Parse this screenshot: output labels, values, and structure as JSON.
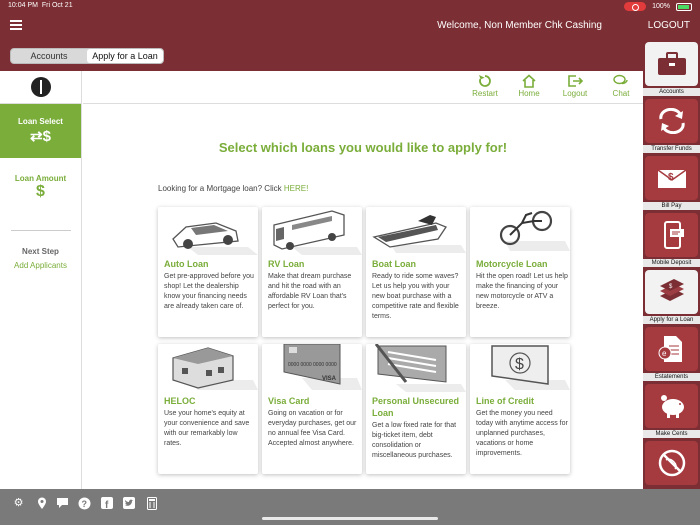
{
  "status": {
    "time": "10:04 PM",
    "date": "Fri Oct 21",
    "battery": "100%"
  },
  "header": {
    "welcome": "Welcome, Non Member Chk Cashing",
    "logout": "LOGOUT"
  },
  "tabs": [
    {
      "label": "Accounts"
    },
    {
      "label": "Apply for a Loan"
    }
  ],
  "steps": {
    "loan_select": "Loan Select",
    "loan_amount": "Loan Amount",
    "next_step": "Next Step",
    "add_applicants": "Add Applicants"
  },
  "toolbar": {
    "restart": "Restart",
    "home": "Home",
    "logout": "Logout",
    "chat": "Chat"
  },
  "main": {
    "headline": "Select which loans you would like to apply for!",
    "mortgage_prefix": "Looking for a Mortgage loan? Click ",
    "mortgage_link": "HERE!"
  },
  "loans": [
    {
      "title": "Auto Loan",
      "desc": "Get pre-approved before you shop! Let the dealership know your financing needs are already taken care of."
    },
    {
      "title": "RV Loan",
      "desc": "Make that dream purchase and hit the road with an affordable RV Loan that's perfect for you."
    },
    {
      "title": "Boat Loan",
      "desc": "Ready to ride some waves? Let us help you with your new boat purchase with a competitive rate and flexible terms."
    },
    {
      "title": "Motorcycle Loan",
      "desc": "Hit the open road! Let us help make the financing of your new motorcycle or ATV a breeze."
    },
    {
      "title": "HELOC",
      "desc": "Use your home's equity at your convenience and save with our remarkably low rates."
    },
    {
      "title": "Visa Card",
      "desc": "Going on vacation or for everyday purchases, get our no annual fee Visa Card. Accepted almost anywhere."
    },
    {
      "title": "Personal Unsecured Loan",
      "desc": "Get a low fixed rate for that big-ticket item, debt consolidation or miscellaneous purchases."
    },
    {
      "title": "Line of Credit",
      "desc": "Get the money you need today with anytime access for unplanned purchases, vacations or home improvements."
    }
  ],
  "sidebar": [
    {
      "label": "Accounts"
    },
    {
      "label": "Transfer Funds"
    },
    {
      "label": "Bill Pay"
    },
    {
      "label": "Mobile Deposit"
    },
    {
      "label": "Apply for a Loan"
    },
    {
      "label": "Estatements"
    },
    {
      "label": "Make Cents"
    },
    {
      "label": ""
    }
  ],
  "card_text": {
    "visa_number": "0000 0000 0000 0000",
    "visa_brand": "VISA"
  },
  "colors": {
    "brand": "#7b2e33",
    "accent": "#7aad3a",
    "bottom": "#7a7a7a"
  }
}
